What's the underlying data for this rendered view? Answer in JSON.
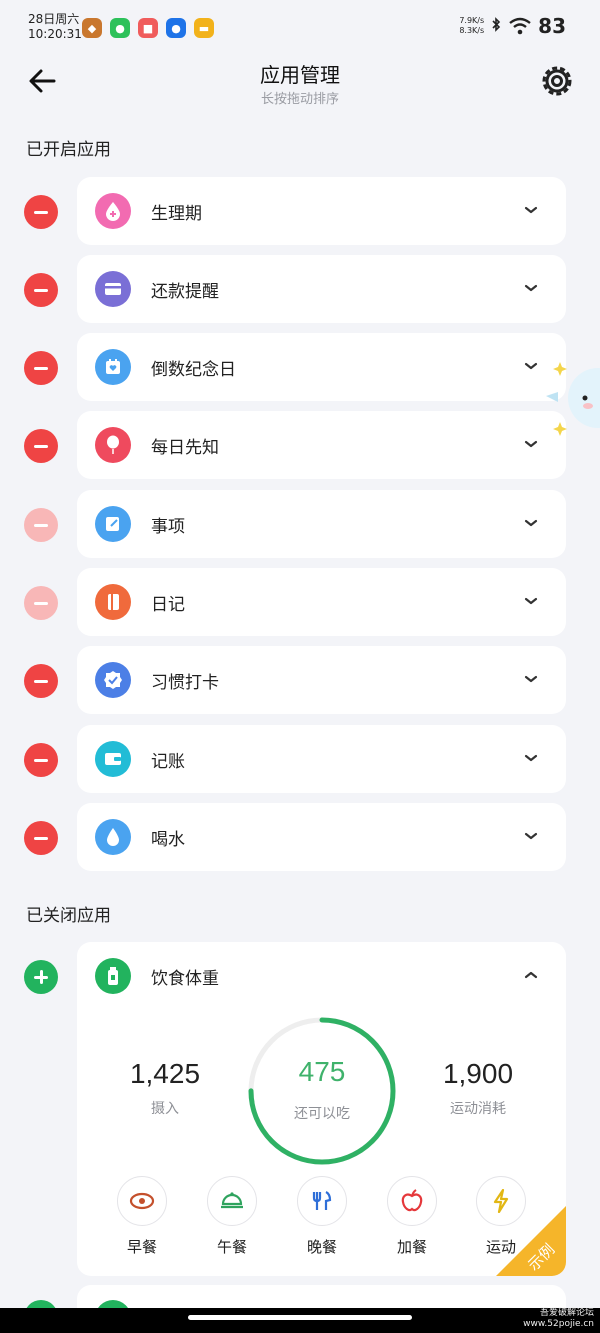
{
  "status_bar": {
    "date": "28日周六",
    "time": "10:20:31",
    "up_speed": "7.9K/s",
    "down_speed": "8.3K/s",
    "battery": "83"
  },
  "header": {
    "title": "应用管理",
    "subtitle": "长按拖动排序"
  },
  "enabled_section": {
    "title": "已开启应用",
    "items": [
      {
        "label": "生理期",
        "icon": "drop-plus-icon",
        "color": "#f26bb1"
      },
      {
        "label": "还款提醒",
        "icon": "card-icon",
        "color": "#7a6fd6"
      },
      {
        "label": "倒数纪念日",
        "icon": "calendar-heart-icon",
        "color": "#4aa3f0"
      },
      {
        "label": "每日先知",
        "icon": "balloon-icon",
        "color": "#ef4a5e"
      },
      {
        "label": "事项",
        "icon": "note-edit-icon",
        "color": "#4aa3f0"
      },
      {
        "label": "日记",
        "icon": "notebook-icon",
        "color": "#f06a3c"
      },
      {
        "label": "习惯打卡",
        "icon": "badge-check-icon",
        "color": "#4c7fe6"
      },
      {
        "label": "记账",
        "icon": "wallet-icon",
        "color": "#22bcd6"
      },
      {
        "label": "喝水",
        "icon": "water-drop-icon",
        "color": "#4aa3f0"
      }
    ]
  },
  "disabled_section": {
    "title": "已关闭应用",
    "item": {
      "label": "饮食体重",
      "color": "#22b35e",
      "intake": {
        "value": "1,425",
        "label": "摄入"
      },
      "remaining": {
        "value": "475",
        "label": "还可以吃",
        "progress": 0.75
      },
      "burned": {
        "value": "1,900",
        "label": "运动消耗"
      },
      "meals": [
        {
          "label": "早餐",
          "icon": "meat-icon"
        },
        {
          "label": "午餐",
          "icon": "dish-cover-icon"
        },
        {
          "label": "晚餐",
          "icon": "utensils-icon"
        },
        {
          "label": "加餐",
          "icon": "apple-icon"
        },
        {
          "label": "运动",
          "icon": "lightning-icon"
        }
      ],
      "badge": "示例"
    }
  },
  "watermark": {
    "line1": "吾爱破解论坛",
    "line2": "www.52pojie.cn"
  }
}
